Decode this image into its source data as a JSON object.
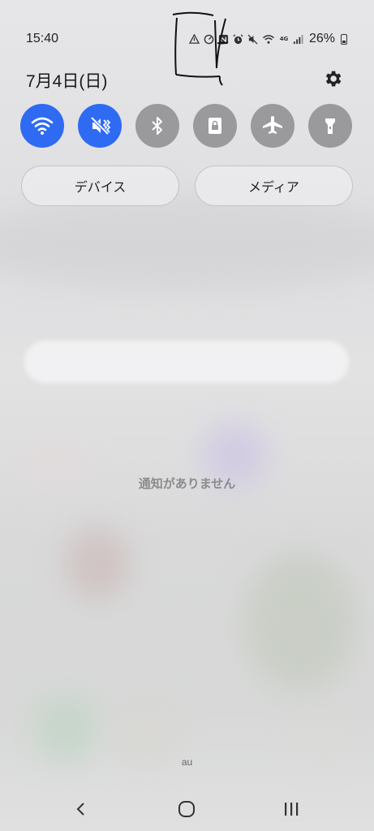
{
  "status_bar": {
    "time": "15:40",
    "battery_percent": "26%",
    "icons": [
      "warning-icon",
      "data-saver-icon",
      "nfc-icon",
      "alarm-icon",
      "mute-icon",
      "wifi-icon",
      "4g-icon",
      "signal-icon",
      "battery-icon"
    ],
    "network_label": "4G"
  },
  "header": {
    "date": "7月4日(日)"
  },
  "quick_toggles": [
    {
      "name": "wifi",
      "state": "on",
      "icon": "wifi-icon"
    },
    {
      "name": "mute",
      "state": "on",
      "icon": "mute-icon"
    },
    {
      "name": "bluetooth",
      "state": "off",
      "icon": "bluetooth-icon"
    },
    {
      "name": "rotation-lock",
      "state": "off",
      "icon": "lock-icon"
    },
    {
      "name": "airplane",
      "state": "off",
      "icon": "airplane-icon"
    },
    {
      "name": "flashlight",
      "state": "off",
      "icon": "flashlight-icon"
    }
  ],
  "buttons": {
    "devices": "デバイス",
    "media": "メディア"
  },
  "notifications": {
    "empty_text": "通知がありません"
  },
  "carrier": "au",
  "colors": {
    "accent": "#2f6bf2",
    "toggle_off": "#9a9a9c"
  }
}
